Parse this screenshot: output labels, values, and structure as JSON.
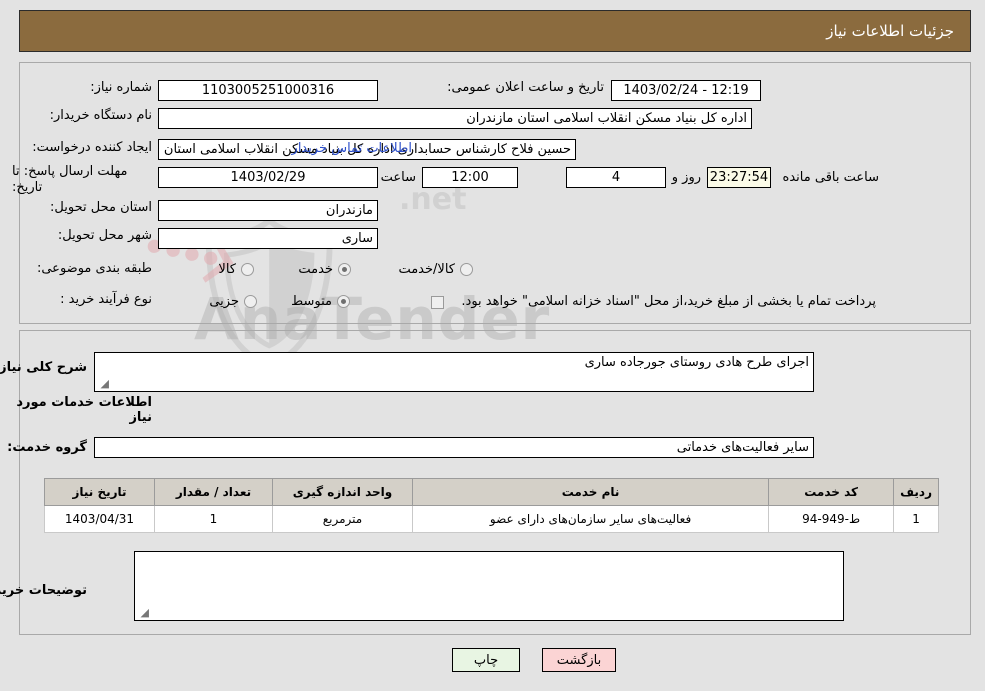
{
  "header": {
    "title": "جزئیات اطلاعات نیاز"
  },
  "watermark": {
    "text": "AnaTender",
    "suffix": ".net"
  },
  "fields": {
    "need_number": {
      "label": "شماره نیاز:",
      "value": "1103005251000316"
    },
    "announce_datetime": {
      "label": "تاریخ و ساعت اعلان عمومی:",
      "value": "12:19 - 1403/02/24"
    },
    "buyer_org": {
      "label": "نام دستگاه خریدار:",
      "value": "اداره کل بنیاد مسکن انقلاب اسلامی استان مازندران"
    },
    "request_creator": {
      "label": "ایجاد کننده درخواست:",
      "value": "حسین فلاح کارشناس حسابداری اداره کل بنیاد مسکن انقلاب اسلامی استان م",
      "link": "اطلاعات تماس خریدار"
    },
    "response_deadline": {
      "label": "مهلت ارسال پاسخ: تا تاریخ:",
      "date": "1403/02/29",
      "hour_label": "ساعت",
      "time": "12:00",
      "days": "4",
      "days_label": "روز و",
      "countdown": "23:27:54",
      "remaining_label": "ساعت باقی مانده"
    },
    "delivery_province": {
      "label": "استان محل تحویل:",
      "value": "مازندران"
    },
    "delivery_city": {
      "label": "شهر محل تحویل:",
      "value": "ساری"
    },
    "subject_category": {
      "label": "طبقه بندی موضوعی:",
      "options": [
        {
          "label": "کالا",
          "selected": false
        },
        {
          "label": "خدمت",
          "selected": true
        },
        {
          "label": "کالا/خدمت",
          "selected": false
        }
      ]
    },
    "purchase_process": {
      "label": "نوع فرآیند خرید :",
      "options": [
        {
          "label": "جزیی",
          "selected": false
        },
        {
          "label": "متوسط",
          "selected": true
        }
      ],
      "checkbox_checked": false,
      "note": "پرداخت تمام یا بخشی از مبلغ خرید،از محل \"اسناد خزانه اسلامی\" خواهد بود."
    },
    "general_description": {
      "label": "شرح کلی نیاز:",
      "value": "اجرای طرح هادی روستای جورجاده ساری"
    },
    "services_section_title": "اطلاعات خدمات مورد نیاز",
    "service_group": {
      "label": "گروه خدمت:",
      "value": "سایر فعالیت‌های خدماتی"
    },
    "buyer_notes": {
      "label": "توضیحات خریدار:",
      "value": ""
    }
  },
  "table": {
    "columns": [
      "ردیف",
      "کد خدمت",
      "نام خدمت",
      "واحد اندازه گیری",
      "تعداد / مقدار",
      "تاریخ نیاز"
    ],
    "rows": [
      {
        "row_no": "1",
        "service_code": "ط-949-94",
        "service_name": "فعالیت‌های سایر سازمان‌های دارای عضو",
        "unit": "مترمربع",
        "quantity": "1",
        "need_date": "1403/04/31"
      }
    ]
  },
  "buttons": {
    "print": "چاپ",
    "back": "بازگشت"
  },
  "colors": {
    "header_bg": "#8b6b3e",
    "page_bg": "#e3e3e3",
    "link": "#2b4ecb",
    "btn_print_bg": "#e8f5e3",
    "btn_back_bg": "#fbd4d4",
    "countdown_bg": "#fbfbe8",
    "table_header_bg": "#d4d0c8"
  }
}
